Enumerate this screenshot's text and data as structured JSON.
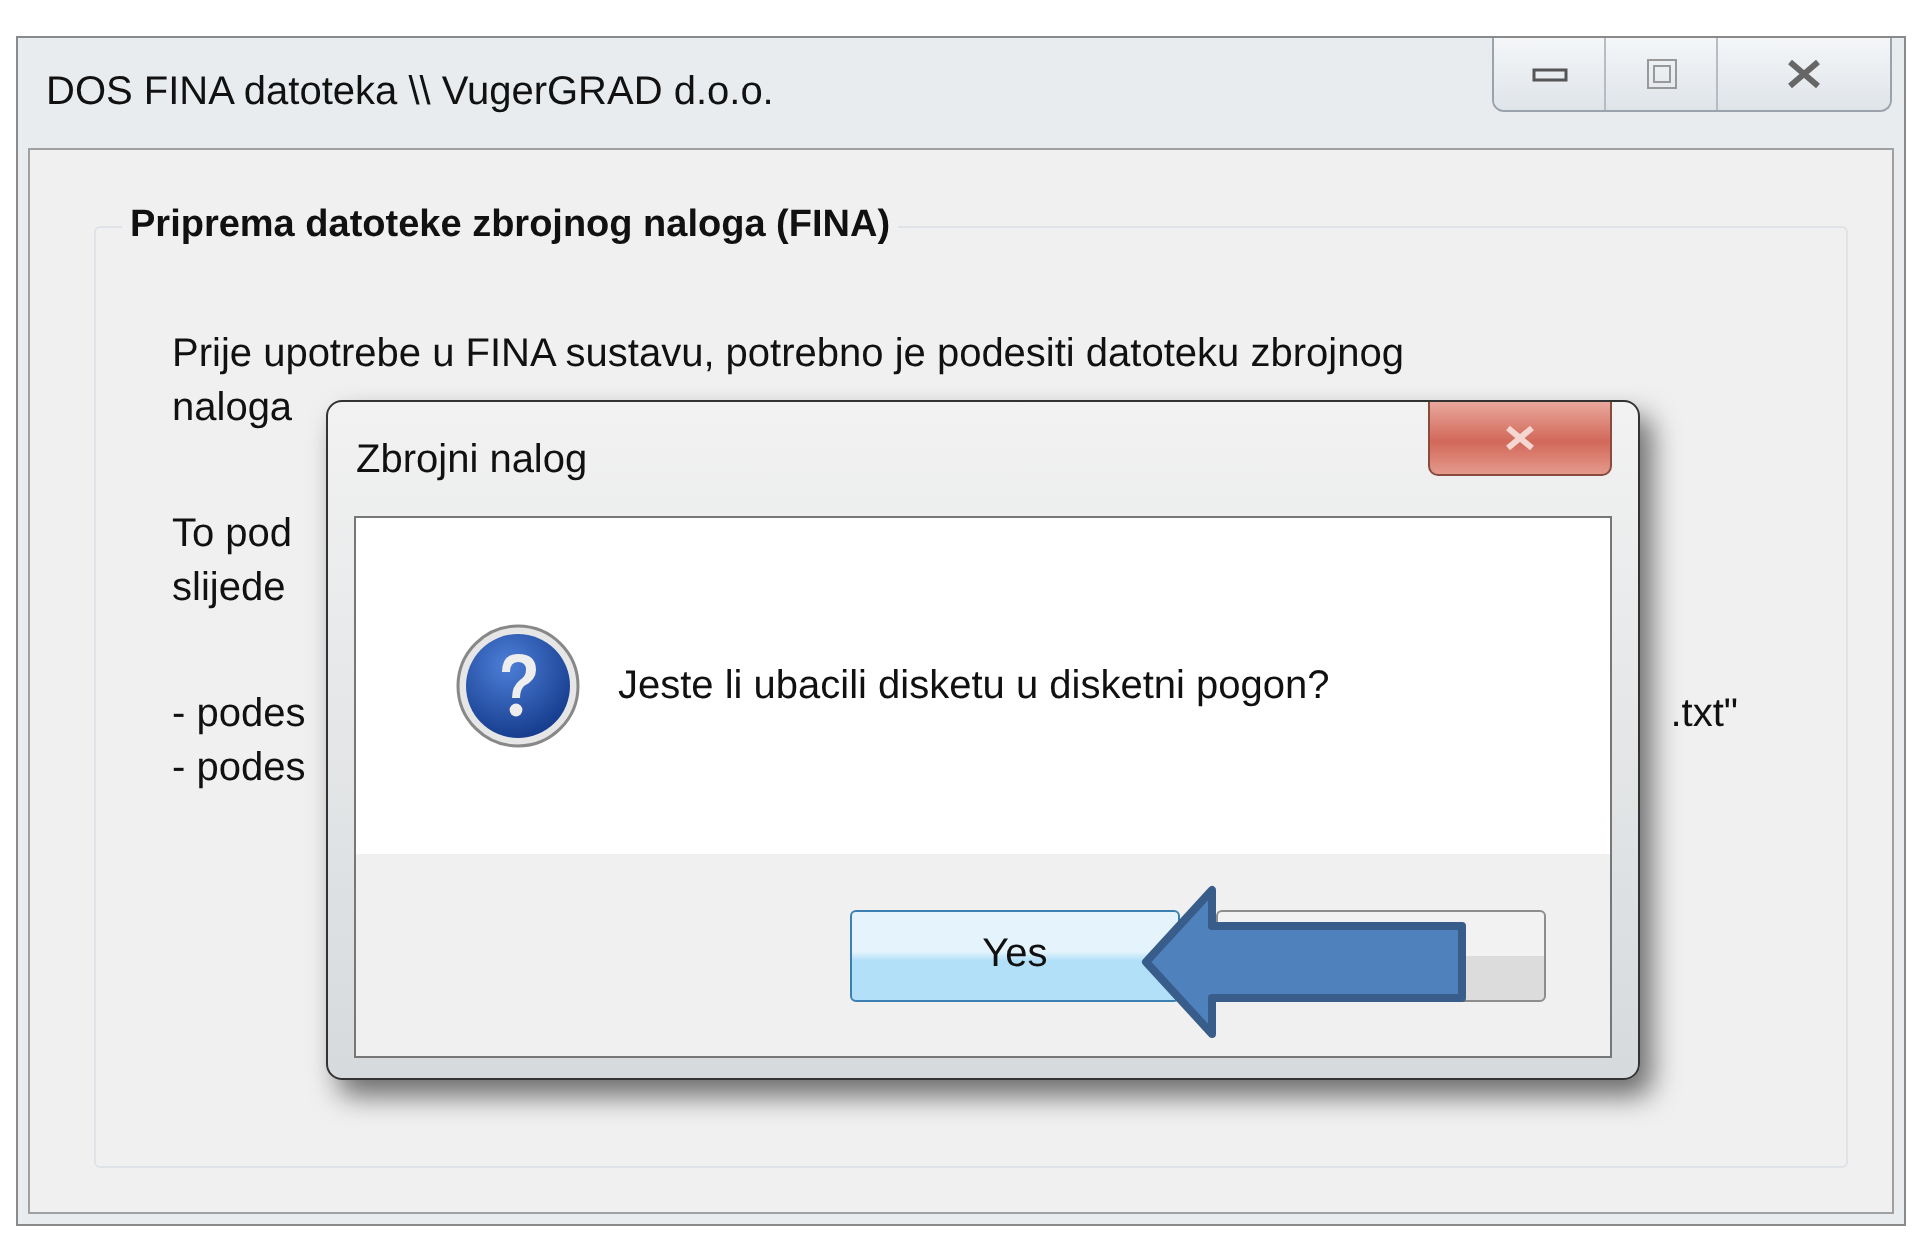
{
  "window": {
    "title": "DOS FINA datoteka \\\\ VugerGRAD d.o.o."
  },
  "group": {
    "title": "Priprema datoteke zbrojnog naloga (FINA)",
    "paragraphs": [
      [
        {
          "text": "Prije upotrebe u FINA sustavu, potrebno je podesiti datoteku zbrojnog"
        },
        {
          "text": "naloga"
        }
      ],
      [
        {
          "text": "To pod"
        },
        {
          "text": "slijede"
        }
      ],
      [
        {
          "text": "- podes",
          "tail": ".txt\""
        },
        {
          "text": "- podes"
        }
      ]
    ]
  },
  "dialog": {
    "title": "Zbrojni nalog",
    "message": "Jeste li ubacili disketu u disketni pogon?",
    "buttons": [
      {
        "label": "Yes",
        "focused": true
      },
      {
        "focused": false
      }
    ]
  }
}
